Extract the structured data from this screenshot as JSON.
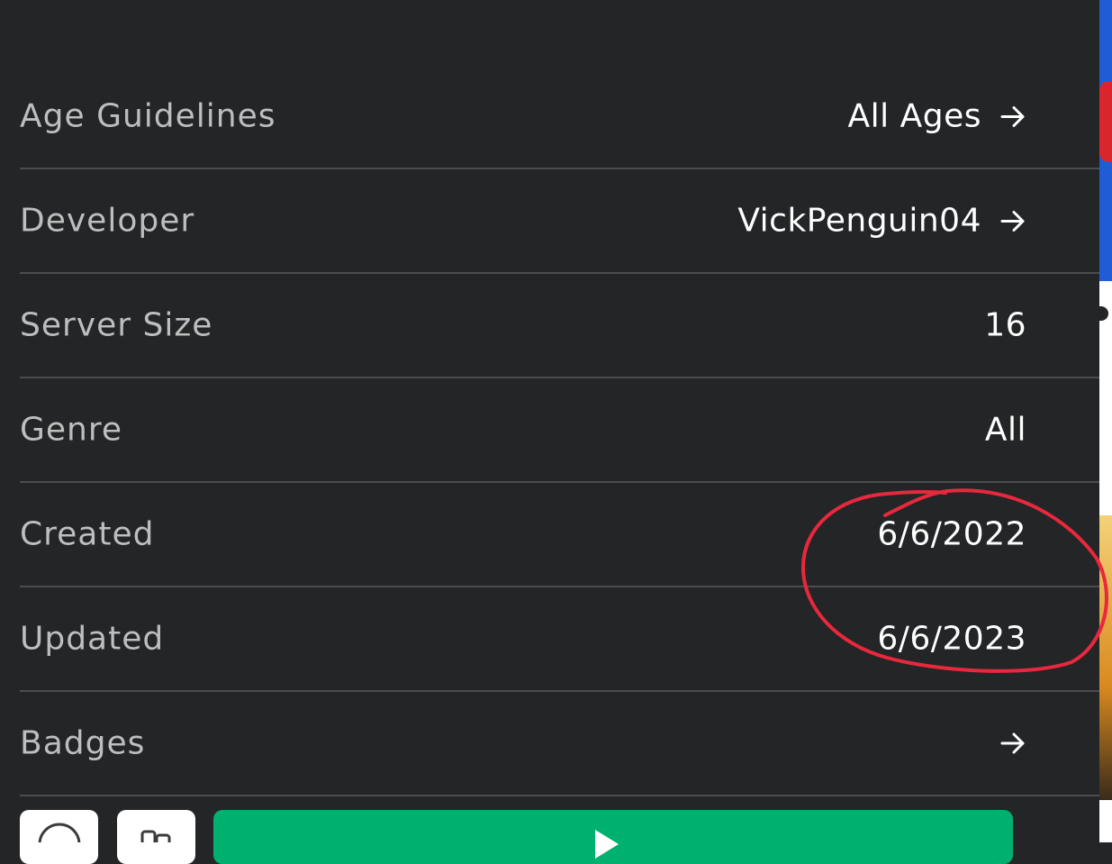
{
  "rows": [
    {
      "label": "Age Guidelines",
      "value": "All Ages",
      "arrow": true
    },
    {
      "label": "Developer",
      "value": "VickPenguin04",
      "arrow": true
    },
    {
      "label": "Server Size",
      "value": "16",
      "arrow": false
    },
    {
      "label": "Genre",
      "value": "All",
      "arrow": false
    },
    {
      "label": "Created",
      "value": "6/6/2022",
      "arrow": false
    },
    {
      "label": "Updated",
      "value": "6/6/2023",
      "arrow": false
    },
    {
      "label": "Badges",
      "value": "",
      "arrow": true
    }
  ],
  "annotation": {
    "color": "#e8283c",
    "shape": "hand-drawn-circle"
  },
  "colors": {
    "background": "#232527",
    "play_button": "#00b06f",
    "divider": "#4a4c4f"
  },
  "icons": {
    "arrow": "arrow-right-icon",
    "chat": "chat-icon",
    "friends": "friends-icon",
    "play": "play-icon"
  }
}
